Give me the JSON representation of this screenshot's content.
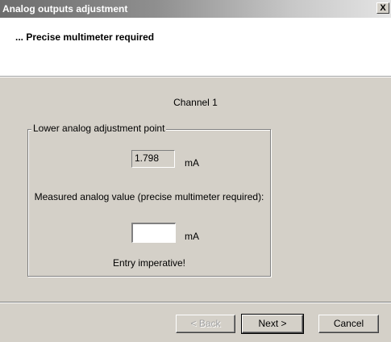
{
  "window": {
    "title": "Analog outputs adjustment",
    "close_glyph": "X"
  },
  "header": {
    "heading": "... Precise multimeter required"
  },
  "main": {
    "channel_label": "Channel 1",
    "group": {
      "legend": "Lower analog adjustment point",
      "readout_value": "1.798",
      "readout_unit": "mA",
      "measured_label": "Measured analog value (precise multimeter required):",
      "input_value": "",
      "input_unit": "mA",
      "entry_note": "Entry imperative!"
    }
  },
  "footer": {
    "back_label": "< Back",
    "next_label": "Next >",
    "cancel_label": "Cancel"
  },
  "colors": {
    "dialog_bg": "#d4d0c8",
    "header_bg": "#ffffff",
    "disabled_text": "#a0a0a0"
  }
}
